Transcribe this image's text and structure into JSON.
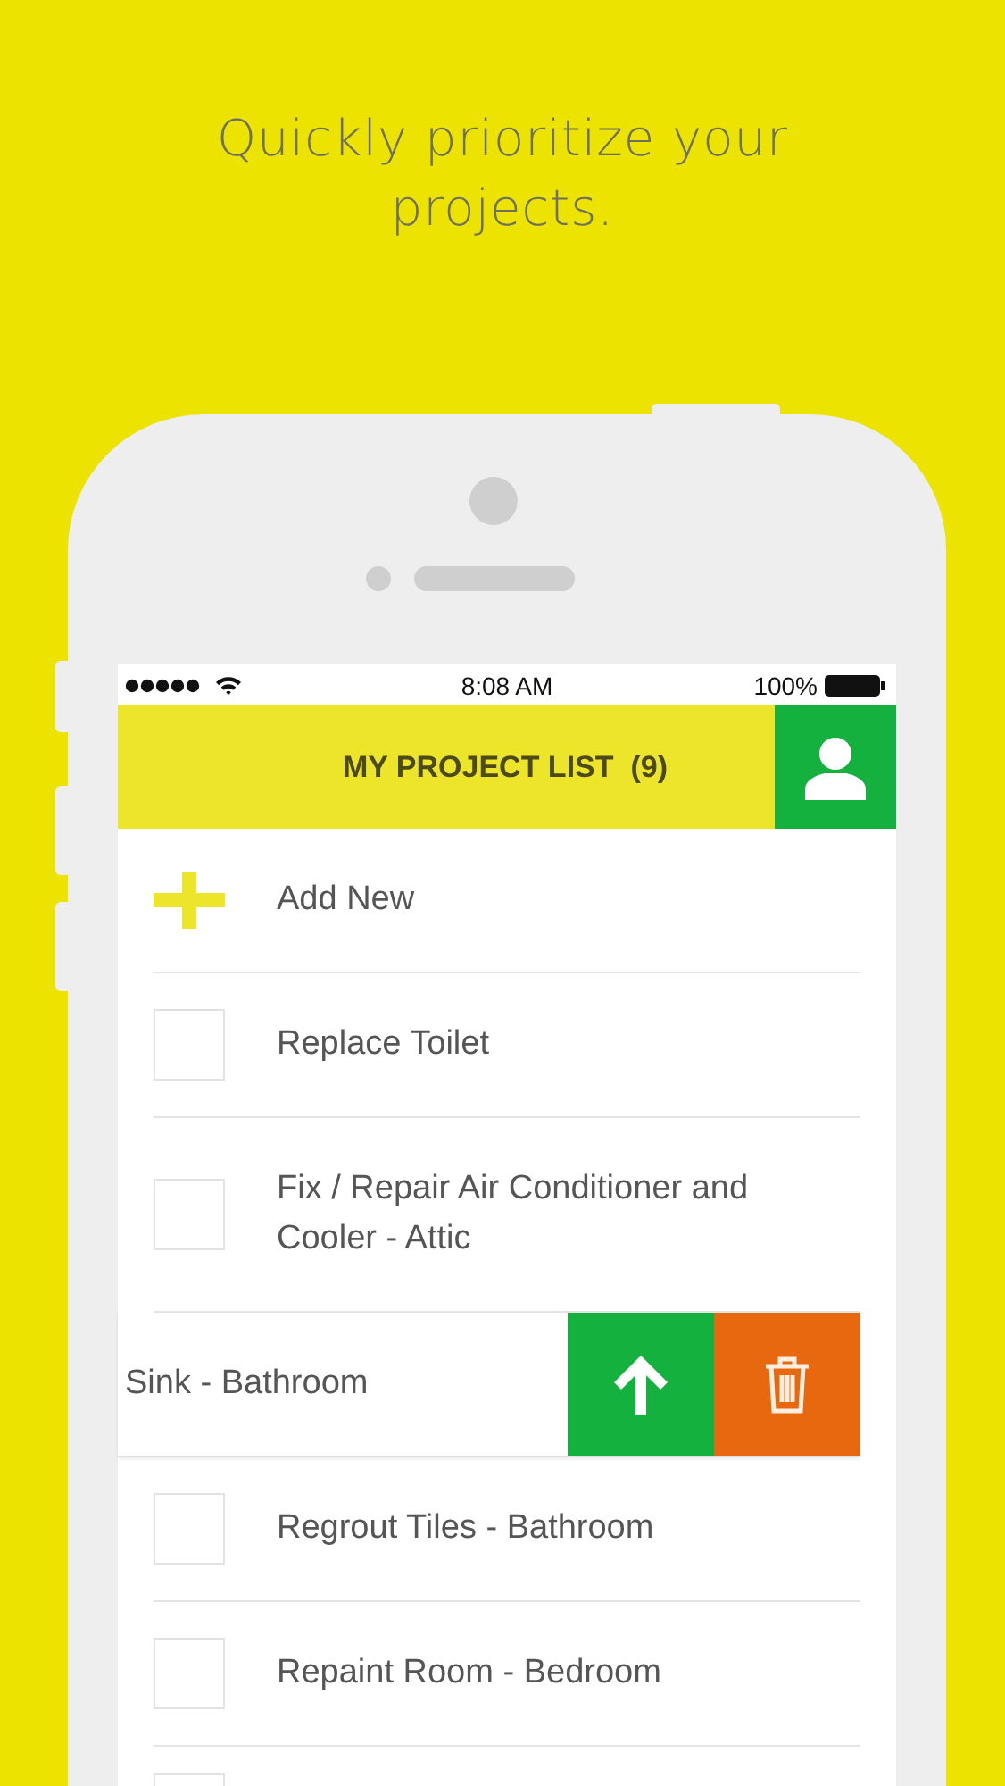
{
  "headline": "Quickly prioritize your projects.",
  "status_bar": {
    "time": "8:08 AM",
    "battery": "100%"
  },
  "header": {
    "title": "MY PROJECT LIST  (9)"
  },
  "rows": [
    {
      "kind": "add",
      "label": "Add New"
    },
    {
      "kind": "task",
      "label": "Replace Toilet",
      "checked": false
    },
    {
      "kind": "task",
      "label": "Fix / Repair Air Conditioner and Cooler - Attic",
      "checked": false
    },
    {
      "kind": "swiped",
      "label": "Sink - Bathroom"
    },
    {
      "kind": "task",
      "label": "Regrout Tiles - Bathroom",
      "checked": false
    },
    {
      "kind": "task",
      "label": "Repaint Room - Bedroom",
      "checked": false
    },
    {
      "kind": "partial",
      "checked": false
    }
  ]
}
